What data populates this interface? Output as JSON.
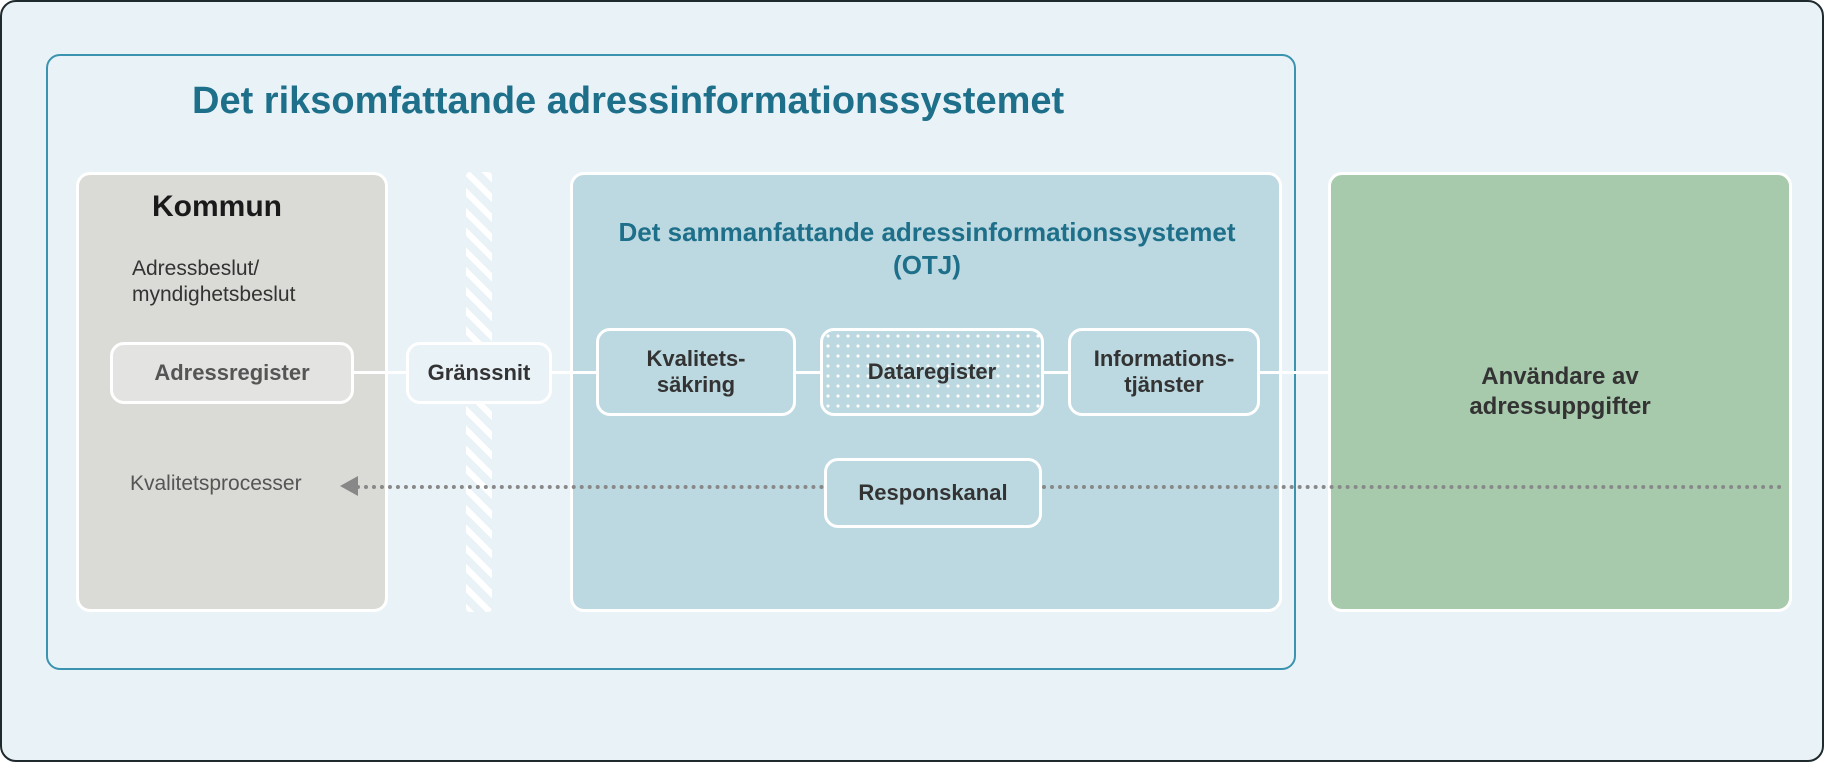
{
  "main": {
    "title": "Det riksomfattande adressinformationssystemet"
  },
  "kommun": {
    "title": "Kommun",
    "subtitle_line1": "Adressbeslut/",
    "subtitle_line2": "myndighetsbeslut",
    "adressregister": "Adressregister",
    "kvalitetsprocesser": "Kvalitetsprocesser"
  },
  "granssnit": "Gränssnit",
  "otj": {
    "title_line1": "Det sammanfattande adressinformationssystemet",
    "title_line2": "(OTJ)",
    "kvalitet_line1": "Kvalitets-",
    "kvalitet_line2": "säkring",
    "dataregister": "Dataregister",
    "info_line1": "Informations-",
    "info_line2": "tjänster",
    "responskanal": "Responskanal"
  },
  "anvandare": {
    "line1": "Användare av",
    "line2": "adressuppgifter"
  }
}
